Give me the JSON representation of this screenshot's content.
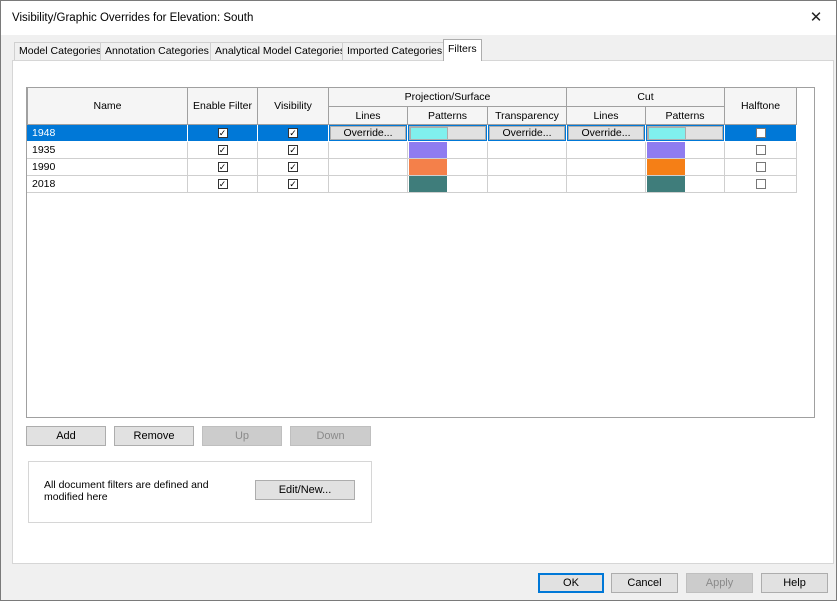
{
  "window": {
    "title": "Visibility/Graphic Overrides for Elevation: South",
    "close_glyph": "✕"
  },
  "tabs": [
    {
      "label": "Model Categories"
    },
    {
      "label": "Annotation Categories"
    },
    {
      "label": "Analytical Model Categories"
    },
    {
      "label": "Imported Categories"
    },
    {
      "label": "Filters",
      "active": true
    }
  ],
  "grid": {
    "headers": {
      "name": "Name",
      "enable_filter": "Enable Filter",
      "visibility": "Visibility",
      "projection_surface": "Projection/Surface",
      "lines": "Lines",
      "patterns": "Patterns",
      "transparency": "Transparency",
      "cut": "Cut",
      "cut_lines": "Lines",
      "cut_patterns": "Patterns",
      "halftone": "Halftone"
    },
    "override_label": "Override...",
    "check_glyph": "✓",
    "rows": [
      {
        "name": "1948",
        "selected": true,
        "enable_filter": true,
        "visibility": true,
        "proj_pattern_color": "#80f0ee",
        "cut_pattern_color": "#80f0ee",
        "halftone": false
      },
      {
        "name": "1935",
        "selected": false,
        "enable_filter": true,
        "visibility": true,
        "proj_pattern_color": "#8f7cf0",
        "cut_pattern_color": "#8f7cf0",
        "halftone": false
      },
      {
        "name": "1990",
        "selected": false,
        "enable_filter": true,
        "visibility": true,
        "proj_pattern_color": "#f4804a",
        "cut_pattern_color": "#f57f16",
        "halftone": false
      },
      {
        "name": "2018",
        "selected": false,
        "enable_filter": true,
        "visibility": true,
        "proj_pattern_color": "#3f7d7b",
        "cut_pattern_color": "#3f7d7b",
        "halftone": false
      }
    ]
  },
  "filter_buttons": {
    "add": "Add",
    "remove": "Remove",
    "up": "Up",
    "down": "Down"
  },
  "info": {
    "text": "All document filters are defined and modified here",
    "edit_new": "Edit/New..."
  },
  "footer": {
    "ok": "OK",
    "cancel": "Cancel",
    "apply": "Apply",
    "help": "Help"
  },
  "colors": {
    "selection": "#0078d7"
  }
}
